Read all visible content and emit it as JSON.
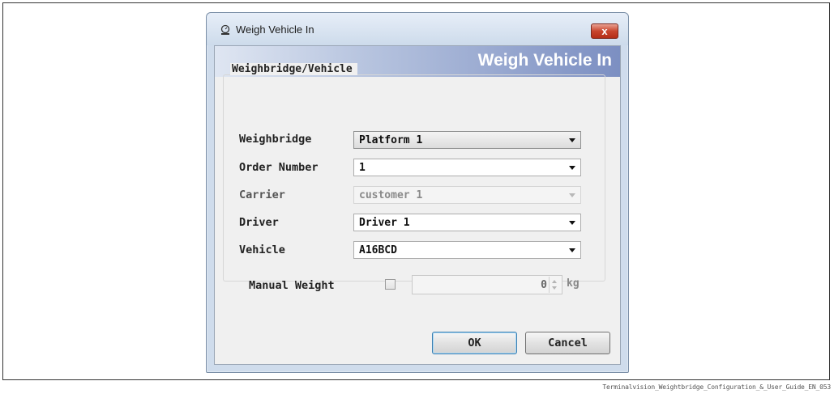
{
  "window": {
    "title": "Weigh Vehicle In",
    "close_label": "x"
  },
  "banner": {
    "title": "Weigh Vehicle In"
  },
  "group": {
    "title": "Weighbridge/Vehicle"
  },
  "fields": {
    "weighbridge": {
      "label": "Weighbridge",
      "value": "Platform 1"
    },
    "order_number": {
      "label": "Order Number",
      "value": "1"
    },
    "carrier": {
      "label": "Carrier",
      "value": "customer 1"
    },
    "driver": {
      "label": "Driver",
      "value": "Driver 1"
    },
    "vehicle": {
      "label": "Vehicle",
      "value": "A16BCD"
    },
    "manual_weight": {
      "label": "Manual Weight",
      "value": "0",
      "unit": "kg"
    }
  },
  "buttons": {
    "ok": "OK",
    "cancel": "Cancel"
  },
  "caption": "Terminalvision_Weightbridge_Configuration_&_User_Guide_EN_053"
}
